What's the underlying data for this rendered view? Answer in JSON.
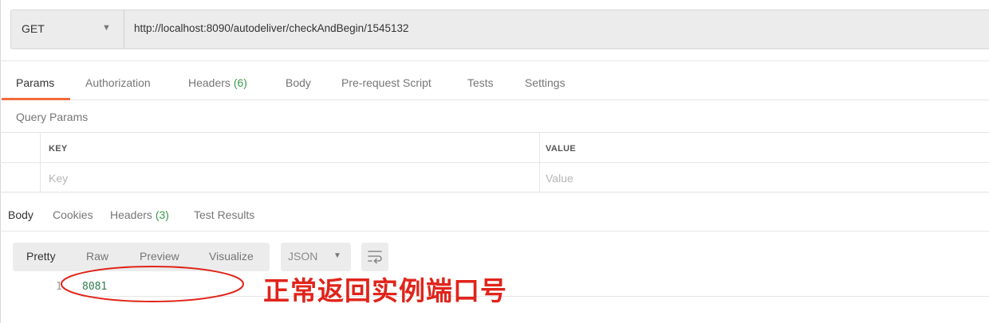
{
  "request": {
    "method": "GET",
    "url": "http://localhost:8090/autodeliver/checkAndBegin/1545132"
  },
  "request_tabs": {
    "params": "Params",
    "authorization": "Authorization",
    "headers": "Headers",
    "headers_count": "(6)",
    "body": "Body",
    "pre_request": "Pre-request Script",
    "tests": "Tests",
    "settings": "Settings"
  },
  "query_params": {
    "title": "Query Params",
    "col_key": "KEY",
    "col_value": "VALUE",
    "key_placeholder": "Key",
    "value_placeholder": "Value"
  },
  "response_tabs": {
    "body": "Body",
    "cookies": "Cookies",
    "headers": "Headers",
    "headers_count": "(3)",
    "test_results": "Test Results"
  },
  "response_view": {
    "pretty": "Pretty",
    "raw": "Raw",
    "preview": "Preview",
    "visualize": "Visualize",
    "format": "JSON"
  },
  "response_body": {
    "line_number": "1",
    "value": "8081"
  },
  "annotation": {
    "text": "正常返回实例端口号",
    "color": "#e0241b"
  },
  "colors": {
    "accent": "#f26b3a",
    "count_green": "#3a9a4a"
  }
}
